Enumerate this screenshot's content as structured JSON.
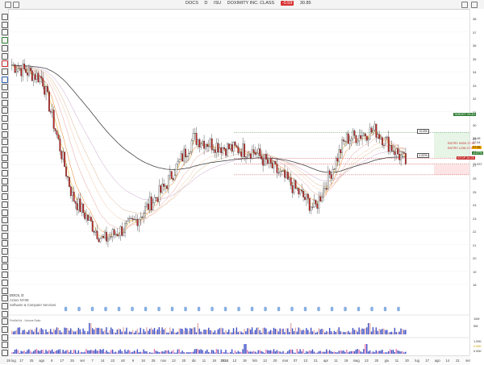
{
  "header": {
    "symbol": "DOCS",
    "timeframe": "D",
    "exchange": "ISU",
    "company": "DOXIMITY INC. CLASS",
    "badge": "-0.59",
    "last_price": "30.85"
  },
  "info": {
    "symbol_line": "DOCS, D",
    "exchange_line": "Azioni NYSE",
    "sector_line": "Software & Computer Services",
    "volume_label": "Profile/Vol - Volume Ratio"
  },
  "price_axis": {
    "ticks": [
      "38",
      "37",
      "36",
      "35",
      "34",
      "33",
      "32",
      "31",
      "30",
      "29",
      "28",
      "27",
      "26",
      "25",
      "24",
      "23",
      "22",
      "21",
      "20",
      "19",
      "18"
    ]
  },
  "x_axis": {
    "labels": [
      "26 lug",
      "17",
      "25",
      "ago",
      "8",
      "17",
      "25",
      "set",
      "7",
      "14",
      "22",
      "ott",
      "9",
      "16",
      "25",
      "nov",
      "13",
      "20",
      "dic",
      "11",
      "18",
      "2024",
      "12",
      "19",
      "feb",
      "13",
      "20",
      "mar",
      "07",
      "13",
      "21",
      "apr",
      "11",
      "19",
      "mag",
      "13",
      "20",
      "giu",
      "11",
      "20",
      "lug",
      "17",
      "ago",
      "14",
      "21",
      "set"
    ]
  },
  "price_tags": {
    "target": "TARGET 29.43",
    "stop": "STOP 26.25",
    "entry_high": "ENTRY HIGH 27.50",
    "entry_low": "ENTRY LOW 27.05",
    "current": "27.25",
    "change": "-0.57%",
    "low_marker": "25.937",
    "mid_tag_a": "28.98",
    "mid_tag_b": "27.64",
    "left_tag": "1.22%",
    "right_tag": "+0.9%"
  },
  "volume_axis": {
    "top": "10M",
    "mid": "5M"
  },
  "indicator_axis": {
    "top": "1.00K",
    "mid": "0.59K",
    "low": "0.00K"
  },
  "chart_data": {
    "type": "candlestick",
    "title": "DOCS, D",
    "ylim": [
      18,
      38
    ],
    "x": [
      "2023-07-26",
      "2023-08-25",
      "2023-09-22",
      "2023-10-16",
      "2023-11-13",
      "2023-12-11",
      "2024-01-12",
      "2024-02-13",
      "2024-03-13",
      "2024-04-11",
      "2024-05-13",
      "2024-06-11",
      "2024-07-17",
      "2024-08-14"
    ],
    "close": [
      34.5,
      33.5,
      24.6,
      21.3,
      22.6,
      25.2,
      29.0,
      28.3,
      28.0,
      26.0,
      23.7,
      28.9,
      29.6,
      27.2
    ],
    "overlays": [
      "ema_fan",
      "sma_200"
    ],
    "levels": {
      "target": 29.43,
      "entry_high": 27.5,
      "entry_low": 27.05,
      "stop": 26.25
    },
    "colors": {
      "up": "#f5f5f5",
      "down": "#c62828",
      "sma200": "#444444",
      "volume": "#3e4fc4",
      "target_zone": "#e6f5e6",
      "stop_zone": "#fde5e5"
    }
  }
}
